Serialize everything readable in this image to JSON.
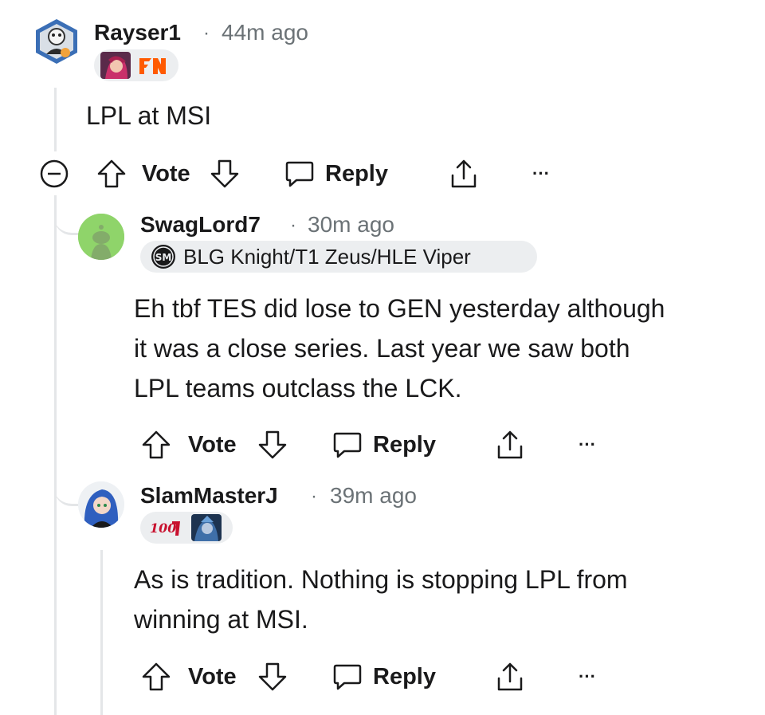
{
  "comments": [
    {
      "username": "Rayser1",
      "separator": "·",
      "time": "44m ago",
      "flair_text": "",
      "body_lines": [
        "LPL at MSI"
      ],
      "actions": {
        "vote": "Vote",
        "reply": "Reply",
        "more": "···"
      }
    },
    {
      "username": "SwagLord7",
      "separator": "·",
      "time": "30m ago",
      "flair_text": "BLG Knight/T1 Zeus/HLE Viper",
      "body_lines": [
        "Eh tbf TES did lose to GEN yesterday although",
        "it was a close series. Last year we saw both",
        "LPL teams outclass the LCK."
      ],
      "actions": {
        "vote": "Vote",
        "reply": "Reply",
        "more": "···"
      }
    },
    {
      "username": "SlamMasterJ",
      "separator": "·",
      "time": "39m ago",
      "flair_text": "",
      "body_lines": [
        "As is tradition. Nothing is stopping LPL from",
        "winning at MSI."
      ],
      "actions": {
        "vote": "Vote",
        "reply": "Reply",
        "more": "···"
      }
    }
  ],
  "colors": {
    "text": "#1a1a1b",
    "meta": "#6b7276",
    "thread_line": "#e4e6e8",
    "flair_bg": "#eceef0",
    "fnatic_orange": "#ff5a00"
  }
}
